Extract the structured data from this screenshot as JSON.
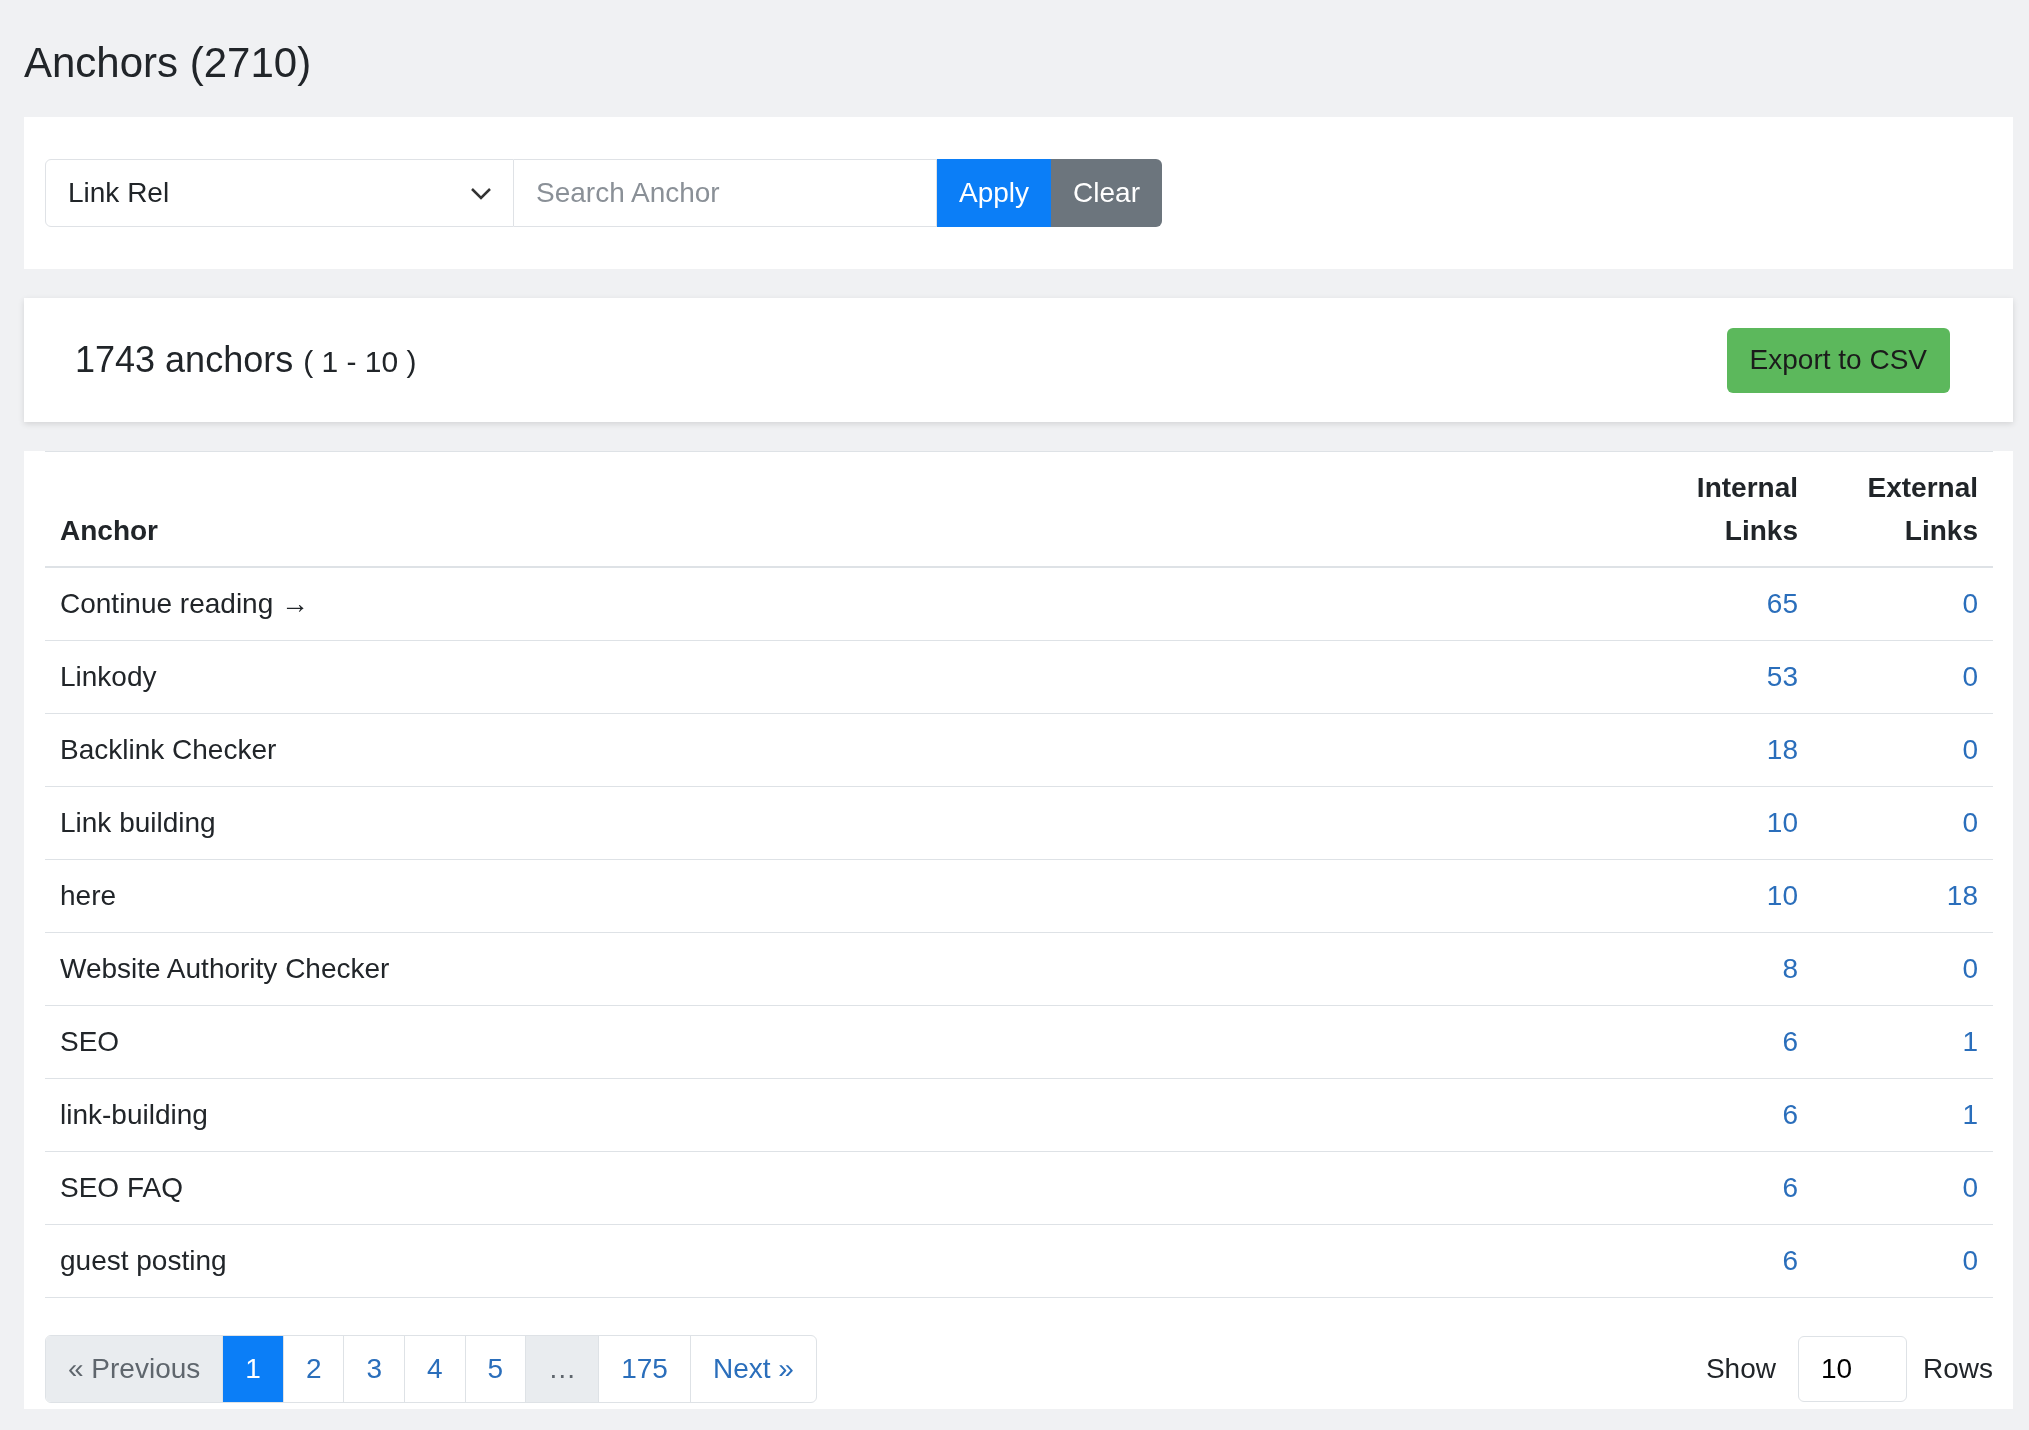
{
  "title": "Anchors (2710)",
  "filter": {
    "select": {
      "value": "Link Rel"
    },
    "search": {
      "placeholder": "Search Anchor"
    },
    "buttons": [
      {
        "label": "Apply",
        "kind": "primary"
      },
      {
        "label": "Clear",
        "kind": "secondary"
      }
    ]
  },
  "summary": {
    "count": "1743 anchors",
    "range": "( 1 - 10 )",
    "export_button": "Export to CSV"
  },
  "table": {
    "columns": [
      "Anchor",
      "Internal Links",
      "External Links"
    ],
    "rows": [
      {
        "anchor": "Continue reading →",
        "internal": "65",
        "external": "0"
      },
      {
        "anchor": "Linkody",
        "internal": "53",
        "external": "0"
      },
      {
        "anchor": "Backlink Checker",
        "internal": "18",
        "external": "0"
      },
      {
        "anchor": "Link building",
        "internal": "10",
        "external": "0"
      },
      {
        "anchor": "here",
        "internal": "10",
        "external": "18"
      },
      {
        "anchor": "Website Authority Checker",
        "internal": "8",
        "external": "0"
      },
      {
        "anchor": "SEO",
        "internal": "6",
        "external": "1"
      },
      {
        "anchor": "link-building",
        "internal": "6",
        "external": "1"
      },
      {
        "anchor": "SEO FAQ",
        "internal": "6",
        "external": "0"
      },
      {
        "anchor": "guest posting",
        "internal": "6",
        "external": "0"
      }
    ]
  },
  "pagination": {
    "pages": [
      {
        "label": "« Previous",
        "selected": false,
        "disabled": true
      },
      {
        "label": "1",
        "selected": true,
        "disabled": false
      },
      {
        "label": "2",
        "selected": false,
        "disabled": false
      },
      {
        "label": "3",
        "selected": false,
        "disabled": false
      },
      {
        "label": "4",
        "selected": false,
        "disabled": false
      },
      {
        "label": "5",
        "selected": false,
        "disabled": false
      },
      {
        "label": "…",
        "selected": false,
        "disabled": true
      },
      {
        "label": "175",
        "selected": false,
        "disabled": false
      },
      {
        "label": "Next »",
        "selected": false,
        "disabled": false
      }
    ],
    "rows_control": {
      "label_before": "Show",
      "value": "10",
      "label_after": "Rows"
    }
  }
}
